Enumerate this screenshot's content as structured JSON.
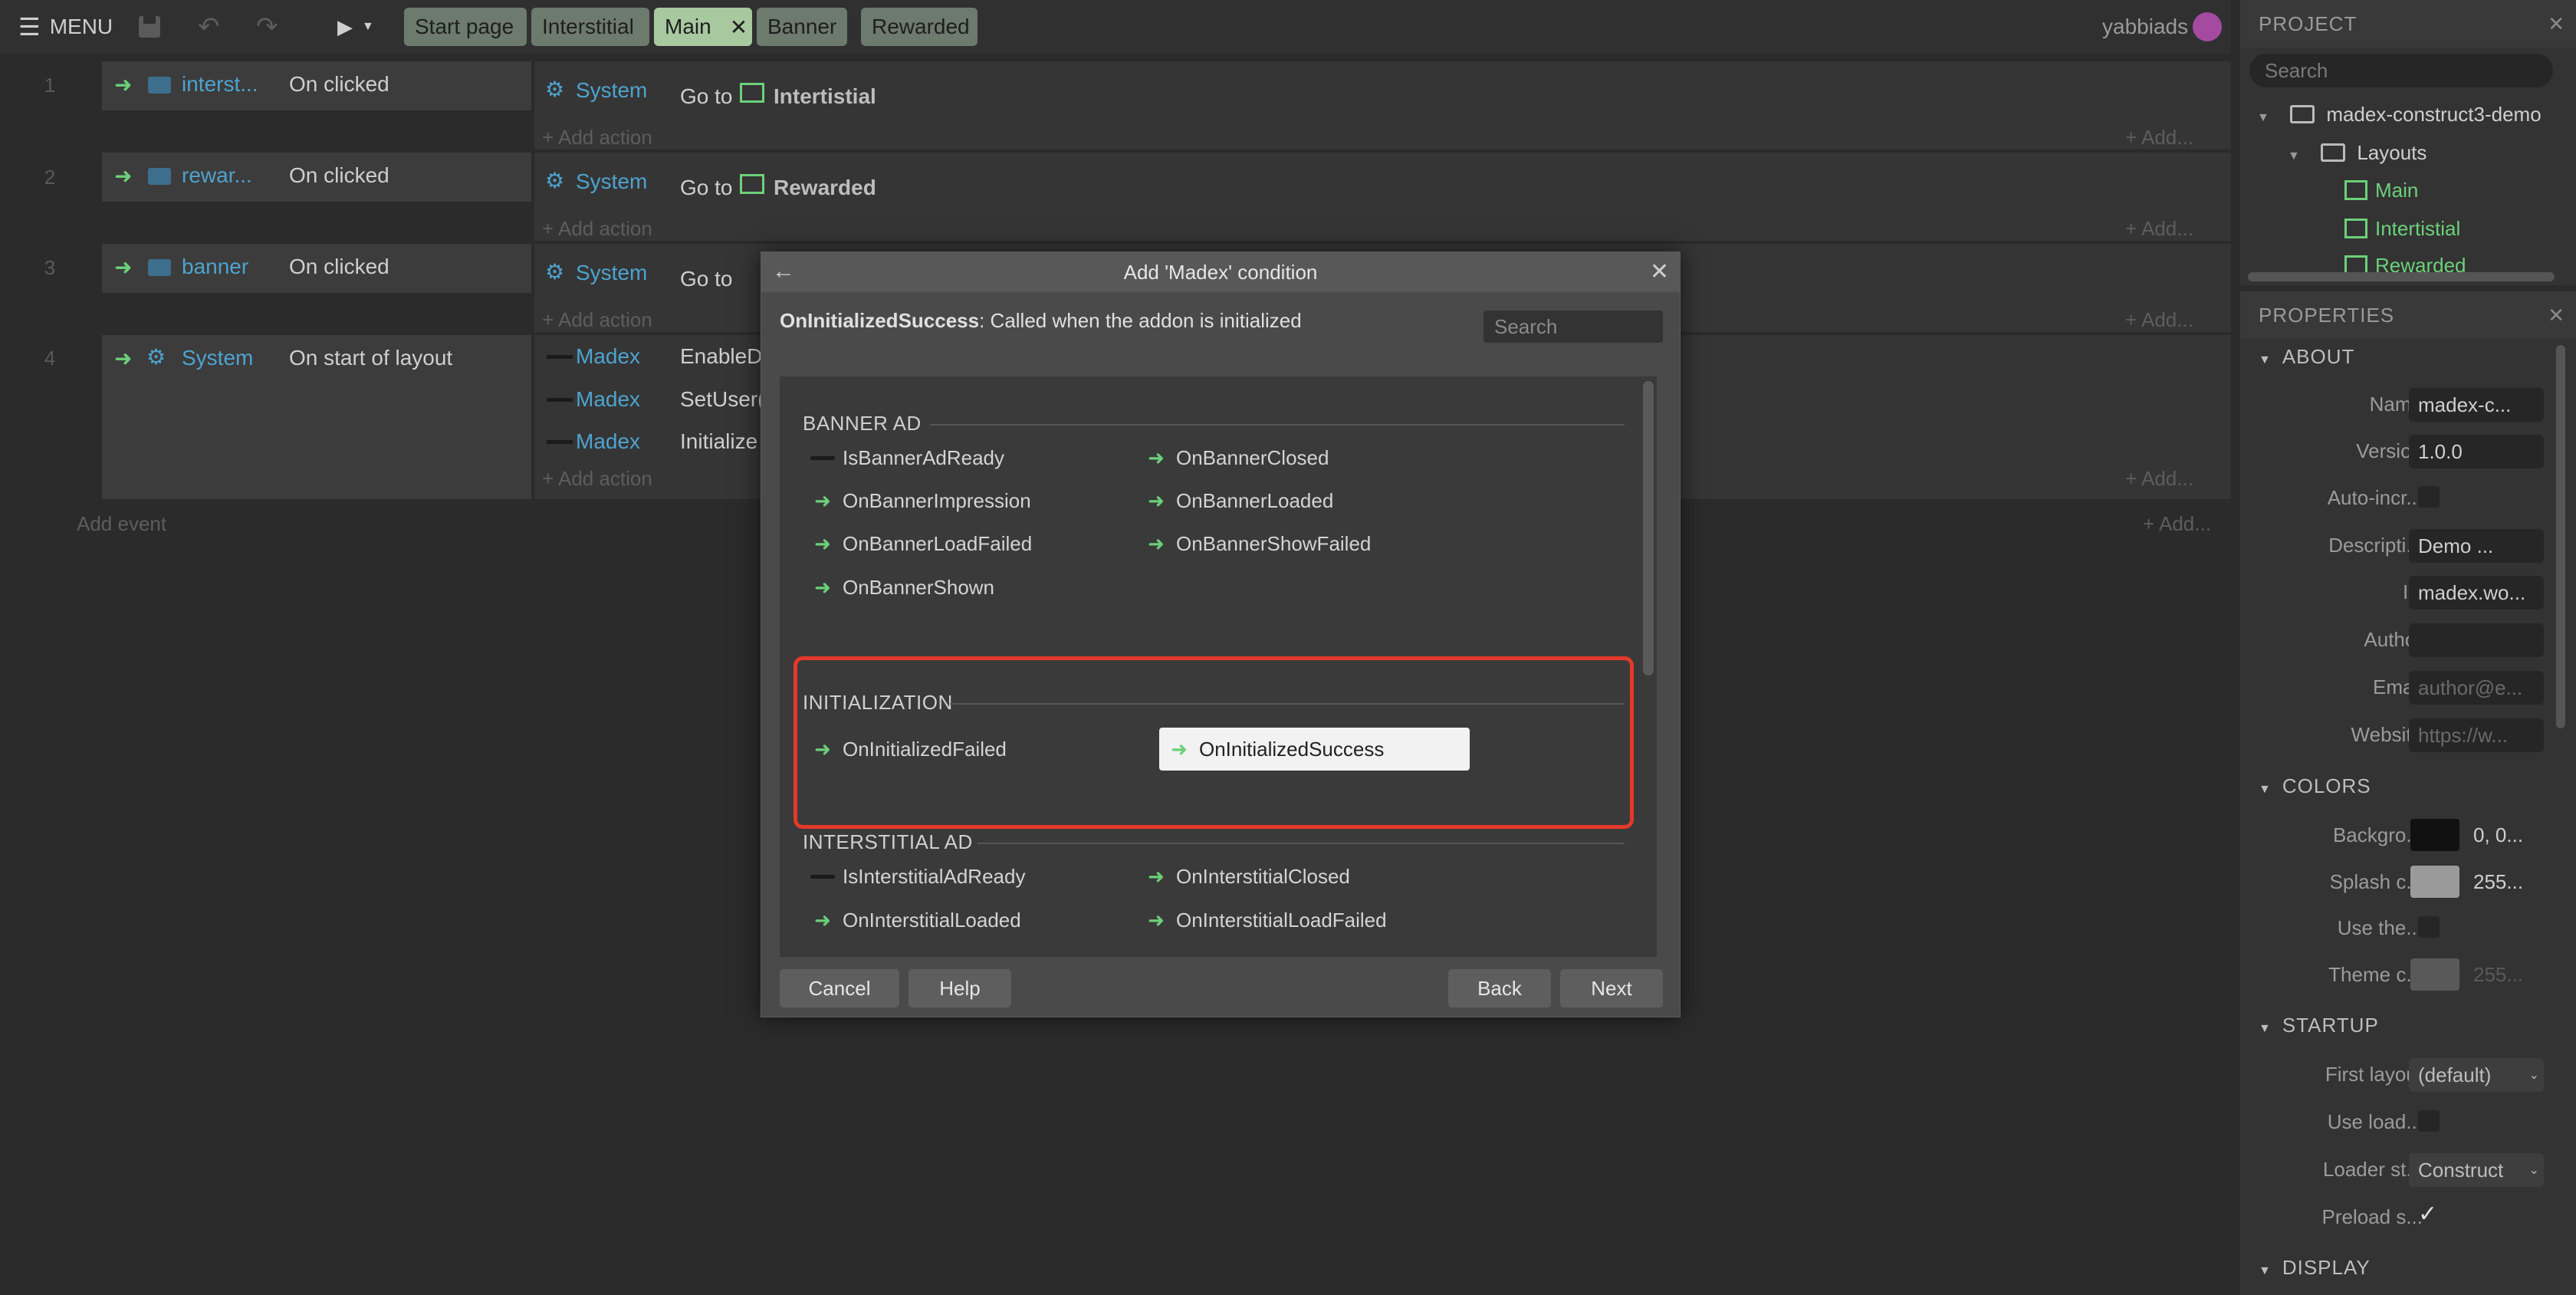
{
  "topbar": {
    "menu_label": "MENU",
    "tabs": [
      {
        "label": "Start page"
      },
      {
        "label": "Interstitial"
      },
      {
        "label": "Main"
      },
      {
        "label": "Banner"
      },
      {
        "label": "Rewarded"
      }
    ],
    "user": "yabbiads"
  },
  "events": [
    {
      "num": "1",
      "object": "interst...",
      "trigger": "On clicked",
      "actions": [
        {
          "object": "System",
          "verb": "Go to",
          "target": "Intertistial"
        }
      ]
    },
    {
      "num": "2",
      "object": "rewar...",
      "trigger": "On clicked",
      "actions": [
        {
          "object": "System",
          "verb": "Go to",
          "target": "Rewarded"
        }
      ]
    },
    {
      "num": "3",
      "object": "banner",
      "trigger": "On clicked",
      "actions": [
        {
          "object": "System",
          "verb": "Go to",
          "target": ""
        }
      ]
    },
    {
      "num": "4",
      "object": "System",
      "trigger": "On start of layout",
      "actions": [
        {
          "object": "Madex",
          "verb": "EnableDe"
        },
        {
          "object": "Madex",
          "verb": "SetUser("
        },
        {
          "object": "Madex",
          "verb": "Initialize"
        }
      ]
    }
  ],
  "sheet": {
    "add_action": "Add action",
    "add_short": "Add...",
    "add_event": "Add event"
  },
  "project": {
    "title": "PROJECT",
    "search_placeholder": "Search",
    "tree": {
      "root": "madex-construct3-demo",
      "folder": "Layouts",
      "items": [
        "Main",
        "Intertistial",
        "Rewarded"
      ]
    }
  },
  "properties": {
    "title": "PROPERTIES",
    "about": {
      "title": "ABOUT",
      "name_label": "Name",
      "name_value": "madex-c...",
      "version_label": "Version",
      "version_value": "1.0.0",
      "autoinc_label": "Auto-incr...",
      "desc_label": "Descripti...",
      "desc_value": "Demo ...",
      "id_label": "ID",
      "id_value": "madex.wo...",
      "author_label": "Author",
      "author_value": "",
      "email_label": "Email",
      "email_placeholder": "author@e...",
      "website_label": "Website",
      "website_placeholder": "https://w..."
    },
    "colors": {
      "title": "COLORS",
      "bg_label": "Backgro...",
      "bg_value": "0, 0...",
      "splash_label": "Splash c...",
      "splash_value": "255...",
      "use_label": "Use the...",
      "theme_label": "Theme c...",
      "theme_value": "255..."
    },
    "startup": {
      "title": "STARTUP",
      "first_label": "First layout",
      "first_value": "(default)",
      "useload_label": "Use load...",
      "loader_label": "Loader st...",
      "loader_value": "Construct",
      "preload_label": "Preload s..."
    },
    "display": {
      "title": "DISPLAY"
    }
  },
  "dialog": {
    "title": "Add 'Madex' condition",
    "desc_name": "OnInitializedSuccess",
    "desc_text": ": Called when the addon is initialized",
    "search_placeholder": "Search",
    "groups": [
      {
        "title": "BANNER AD",
        "items": [
          {
            "label": "IsBannerAdReady",
            "kind": "bar"
          },
          {
            "label": "OnBannerClosed",
            "kind": "arrow"
          },
          {
            "label": "OnBannerImpression",
            "kind": "arrow"
          },
          {
            "label": "OnBannerLoaded",
            "kind": "arrow"
          },
          {
            "label": "OnBannerLoadFailed",
            "kind": "arrow"
          },
          {
            "label": "OnBannerShowFailed",
            "kind": "arrow"
          },
          {
            "label": "OnBannerShown",
            "kind": "arrow"
          }
        ]
      },
      {
        "title": "INITIALIZATION",
        "items": [
          {
            "label": "OnInitializedFailed",
            "kind": "arrow"
          },
          {
            "label": "OnInitializedSuccess",
            "kind": "arrow",
            "selected": true
          }
        ]
      },
      {
        "title": "INTERSTITIAL AD",
        "items": [
          {
            "label": "IsInterstitialAdReady",
            "kind": "bar"
          },
          {
            "label": "OnInterstitialClosed",
            "kind": "arrow"
          },
          {
            "label": "OnInterstitialLoaded",
            "kind": "arrow"
          },
          {
            "label": "OnInterstitialLoadFailed",
            "kind": "arrow"
          }
        ]
      }
    ],
    "buttons": {
      "cancel": "Cancel",
      "help": "Help",
      "back": "Back",
      "next": "Next"
    }
  },
  "colors": {
    "accent_green": "#6cd07a",
    "link_blue": "#4ea3cf",
    "highlight_red": "#e5382b",
    "active_tab": "#a8c89f"
  }
}
